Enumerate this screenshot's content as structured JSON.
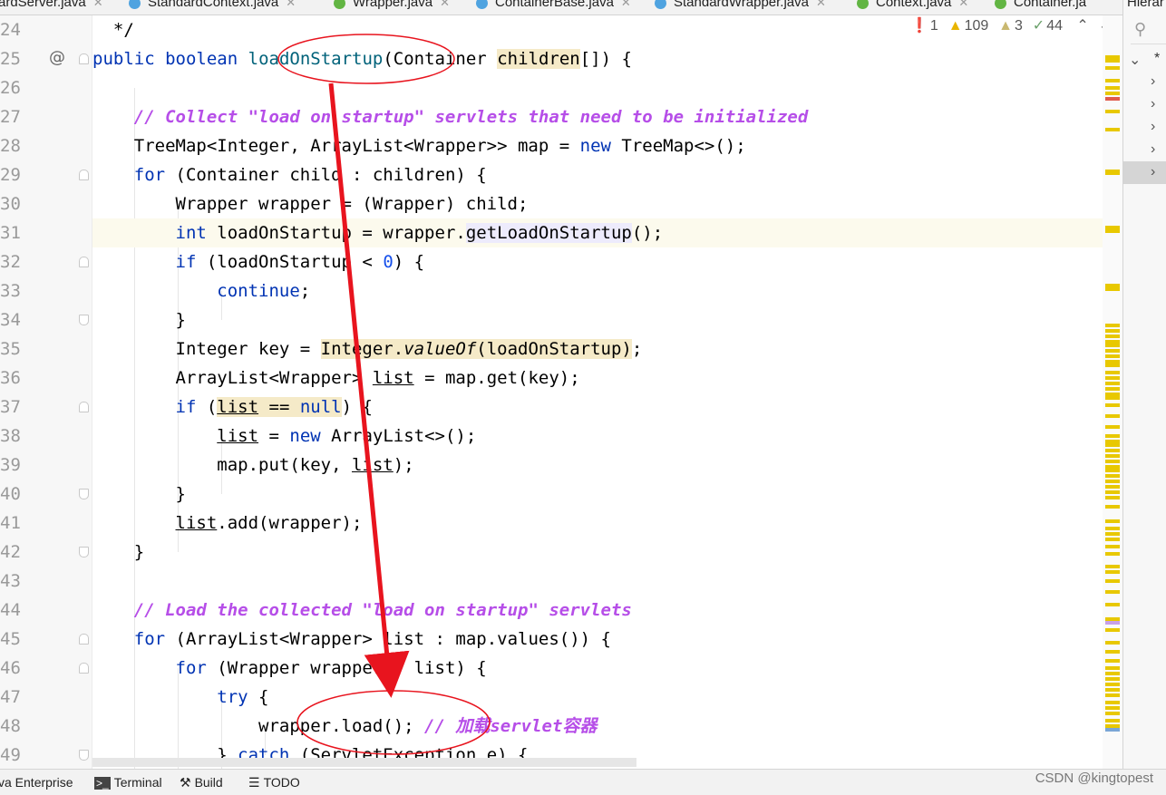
{
  "tabs": [
    {
      "label": "ardServer.java",
      "icon": "class-icon",
      "active": false
    },
    {
      "label": "StandardContext.java",
      "icon": "class-icon",
      "active": true
    },
    {
      "label": "Wrapper.java",
      "icon": "interface-icon",
      "active": false
    },
    {
      "label": "ContainerBase.java",
      "icon": "class-icon",
      "active": false
    },
    {
      "label": "StandardWrapper.java",
      "icon": "class-icon",
      "active": false
    },
    {
      "label": "Context.java",
      "icon": "interface-icon",
      "active": false
    },
    {
      "label": "Container.ja",
      "icon": "interface-icon",
      "active": false
    }
  ],
  "right_panel": {
    "title": "Hierar",
    "tree_root": "*"
  },
  "inspections": {
    "errors": "1",
    "warnings": "109",
    "weak_warnings": "3",
    "typos": "44"
  },
  "line_numbers": [
    "24",
    "25",
    "26",
    "27",
    "28",
    "29",
    "30",
    "31",
    "32",
    "33",
    "34",
    "35",
    "36",
    "37",
    "38",
    "39",
    "40",
    "41",
    "42",
    "43",
    "44",
    "45",
    "46",
    "47",
    "48",
    "49"
  ],
  "gutter": {
    "override_marker": "@"
  },
  "code_lines": [
    "  */",
    "public boolean loadOnStartup(Container children[]) {",
    "",
    "    // Collect \"load on startup\" servlets that need to be initialized",
    "    TreeMap<Integer, ArrayList<Wrapper>> map = new TreeMap<>();",
    "    for (Container child : children) {",
    "        Wrapper wrapper = (Wrapper) child;",
    "        int loadOnStartup = wrapper.getLoadOnStartup();",
    "        if (loadOnStartup < 0) {",
    "            continue;",
    "        }",
    "        Integer key = Integer.valueOf(loadOnStartup);",
    "        ArrayList<Wrapper> list = map.get(key);",
    "        if (list == null) {",
    "            list = new ArrayList<>();",
    "            map.put(key, list);",
    "        }",
    "        list.add(wrapper);",
    "    }",
    "",
    "    // Load the collected \"load on startup\" servlets",
    "    for (ArrayList<Wrapper> list : map.values()) {",
    "        for (Wrapper wrapper : list) {",
    "            try {",
    "                wrapper.load(); // 加载servlet容器",
    "            } catch (ServletException e) {"
  ],
  "current_line": "31",
  "status_bar": {
    "items": [
      "va Enterprise",
      "Terminal",
      "Build",
      "TODO"
    ],
    "watermark": "CSDN @kingtopest"
  },
  "colors": {
    "keyword": "#0033b3",
    "comment": "#b64ee8",
    "number": "#1750eb",
    "annotation": "#e8141e",
    "active_tab": "#4083c9"
  }
}
